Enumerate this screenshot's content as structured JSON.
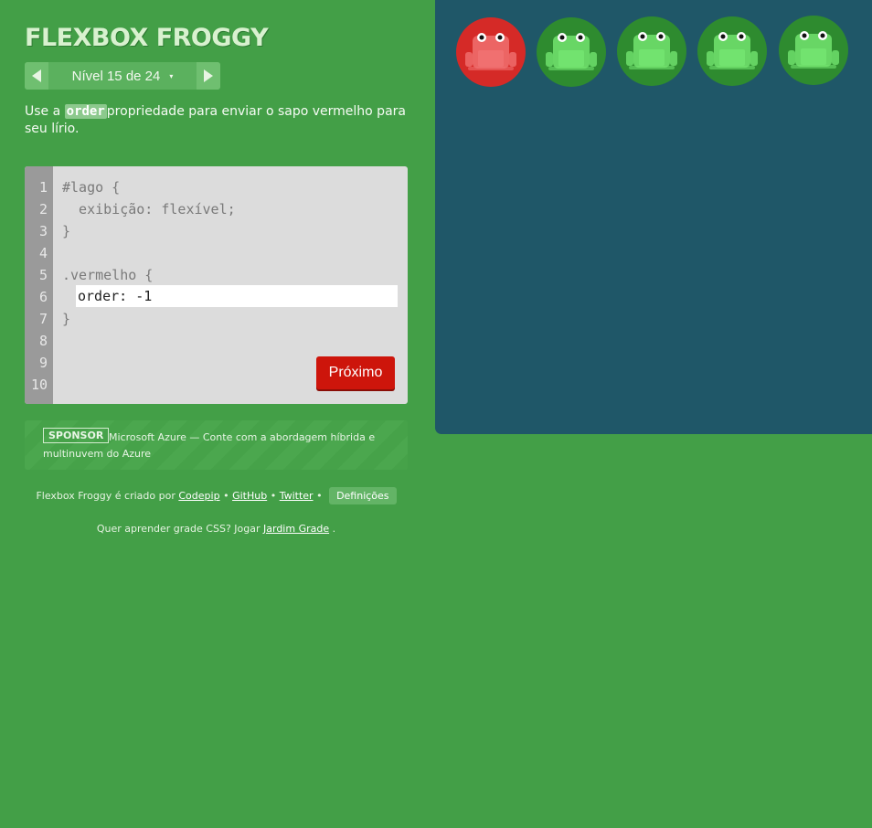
{
  "app": {
    "title": "FLEXBOX FROGGY"
  },
  "level_nav": {
    "prev_icon": "triangle-left-icon",
    "next_icon": "triangle-right-icon",
    "label": "Nível 15 de 24",
    "caret": "▾"
  },
  "instructions": {
    "before": "Use a ",
    "code": "order",
    "after": "propriedade para enviar o sapo vermelho para seu lírio."
  },
  "editor": {
    "line_numbers": [
      "1",
      "2",
      "3",
      "4",
      "5",
      "6",
      "7",
      "8",
      "9",
      "10"
    ],
    "lines": {
      "l1": "#lago {",
      "l2": "  exibição: flexível;",
      "l3": "}",
      "l5": ".vermelho {",
      "l7": "}"
    },
    "input_value": "order: -1",
    "next_button": "Próximo"
  },
  "sponsor": {
    "badge": "SPONSOR",
    "text": "Microsoft Azure — Conte com a abordagem híbrida e multinuvem do Azure"
  },
  "footer": {
    "created_by": "Flexbox Froggy é criado por",
    "codepip": "Codepip",
    "sep": "•",
    "github": "GitHub",
    "twitter": "Twitter",
    "settings": "Definições",
    "grid_prompt": "Quer aprender grade CSS? Jogar",
    "grid_link": "Jardim Grade",
    "grid_end": "."
  },
  "board": {
    "colors": {
      "water": "#1f5768",
      "red_pad": "#d52a27",
      "green_pad": "#2e8b2f",
      "frog_green": "#72e36f",
      "frog_red": "#f07070"
    },
    "frogs": [
      {
        "color": "red",
        "icon": "red-frog-icon"
      },
      {
        "color": "green",
        "icon": "green-frog-icon"
      },
      {
        "color": "green",
        "icon": "green-frog-icon"
      },
      {
        "color": "green",
        "icon": "green-frog-icon"
      },
      {
        "color": "green",
        "icon": "green-frog-icon"
      }
    ]
  }
}
